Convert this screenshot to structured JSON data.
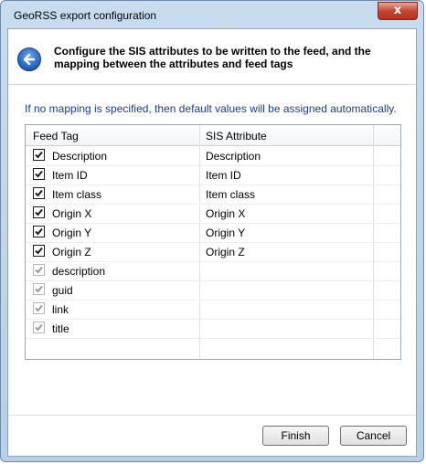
{
  "window": {
    "title": "GeoRSS export configuration",
    "close_glyph": "x"
  },
  "header": {
    "text": "Configure the SIS attributes to be written to the feed, and the mapping between the attributes and feed tags",
    "back_icon": "back-arrow-icon"
  },
  "info": "If no mapping is specified, then default values will be assigned automatically.",
  "grid": {
    "columns": [
      "Feed Tag",
      "SIS Attribute"
    ],
    "rows": [
      {
        "tag": "Description",
        "attribute": "Description",
        "checked": true,
        "enabled": true
      },
      {
        "tag": "Item ID",
        "attribute": "Item ID",
        "checked": true,
        "enabled": true
      },
      {
        "tag": "Item class",
        "attribute": "Item class",
        "checked": true,
        "enabled": true
      },
      {
        "tag": "Origin X",
        "attribute": "Origin X",
        "checked": true,
        "enabled": true
      },
      {
        "tag": "Origin Y",
        "attribute": "Origin Y",
        "checked": true,
        "enabled": true
      },
      {
        "tag": "Origin Z",
        "attribute": "Origin Z",
        "checked": true,
        "enabled": true
      },
      {
        "tag": "description",
        "attribute": "",
        "checked": true,
        "enabled": false
      },
      {
        "tag": "guid",
        "attribute": "",
        "checked": true,
        "enabled": false
      },
      {
        "tag": "link",
        "attribute": "",
        "checked": true,
        "enabled": false
      },
      {
        "tag": "title",
        "attribute": "",
        "checked": true,
        "enabled": false
      }
    ]
  },
  "buttons": {
    "finish": "Finish",
    "cancel": "Cancel"
  }
}
